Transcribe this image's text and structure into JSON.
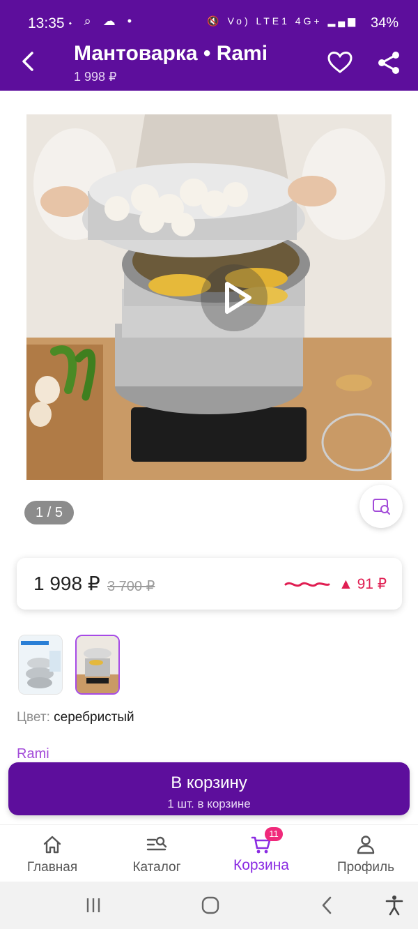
{
  "status_bar": {
    "time": "13:35",
    "left_icons": "𝆺 ⌕ ☁ •",
    "right_icons": "🔇 Vo) LTE1 4G+ ▂▄▆",
    "battery": "34%"
  },
  "header": {
    "title": "Мантоварка • Rami",
    "subtitle_price": "1 998 ₽",
    "back_icon": "back-arrow-icon",
    "favorite_icon": "heart-icon",
    "share_icon": "share-icon"
  },
  "gallery": {
    "page_indicator": "1 / 5",
    "current_page": 1,
    "total_pages": 5,
    "play_icon": "play-icon",
    "visual_search_icon": "image-search-icon"
  },
  "price": {
    "current": "1 998 ₽",
    "old": "3 700 ₽",
    "delta": "▲ 91 ₽",
    "delta_color": "#e01e52"
  },
  "thumbnails": [
    {
      "selected": false,
      "caption": "ДЛЯ ВСЕХ ТИПОВ ПЛИТ"
    },
    {
      "selected": true,
      "caption": ""
    }
  ],
  "attributes": {
    "color_label": "Цвет:",
    "color_value": "серебристый",
    "brand": "Rami"
  },
  "cart_button": {
    "label": "В корзину",
    "sublabel": "1 шт. в корзине"
  },
  "bottom_nav": {
    "items": [
      {
        "label": "Главная",
        "icon": "home-icon",
        "active": false
      },
      {
        "label": "Каталог",
        "icon": "catalog-search-icon",
        "active": false
      },
      {
        "label": "Корзина",
        "icon": "cart-icon",
        "active": true,
        "badge": "11"
      },
      {
        "label": "Профиль",
        "icon": "profile-icon",
        "active": false
      }
    ]
  },
  "colors": {
    "brand_purple": "#5d0e9c",
    "accent_purple": "#8a2be2",
    "badge_pink": "#f0297a"
  }
}
